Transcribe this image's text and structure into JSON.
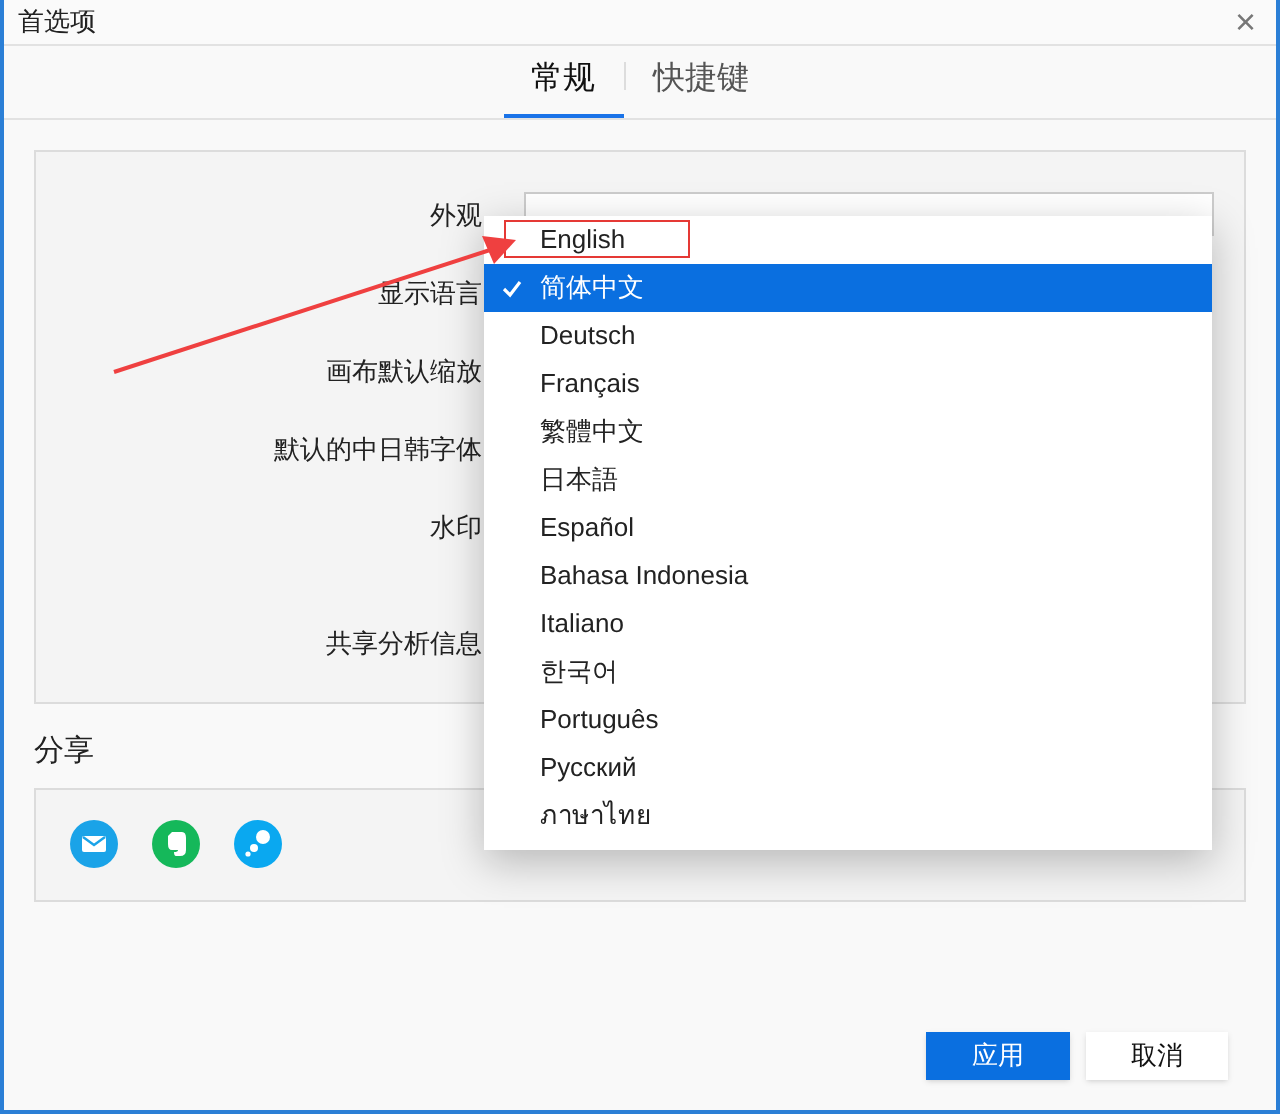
{
  "window": {
    "title": "首选项",
    "close": "×"
  },
  "tabs": [
    {
      "label": "常规",
      "selected": true
    },
    {
      "label": "快捷键",
      "selected": false
    }
  ],
  "settings": [
    "外观",
    "显示语言",
    "画布默认缩放",
    "默认的中日韩字体",
    "水印",
    "共享分析信息"
  ],
  "language_menu": [
    {
      "label": "English",
      "selected": false
    },
    {
      "label": "简体中文",
      "selected": true
    },
    {
      "label": "Deutsch",
      "selected": false
    },
    {
      "label": "Français",
      "selected": false
    },
    {
      "label": "繁體中文",
      "selected": false
    },
    {
      "label": "日本語",
      "selected": false
    },
    {
      "label": "Español",
      "selected": false
    },
    {
      "label": "Bahasa Indonesia",
      "selected": false
    },
    {
      "label": "Italiano",
      "selected": false
    },
    {
      "label": "한국어",
      "selected": false
    },
    {
      "label": "Português",
      "selected": false
    },
    {
      "label": "Русский",
      "selected": false
    },
    {
      "label": "ภาษาไทย",
      "selected": false
    }
  ],
  "share": {
    "title": "分享",
    "icons": [
      {
        "kind": "mail"
      },
      {
        "kind": "evernote"
      },
      {
        "kind": "bubbles"
      }
    ]
  },
  "buttons": [
    {
      "label": "应用",
      "kind": "primary"
    },
    {
      "label": "取消",
      "kind": "secondary"
    }
  ]
}
